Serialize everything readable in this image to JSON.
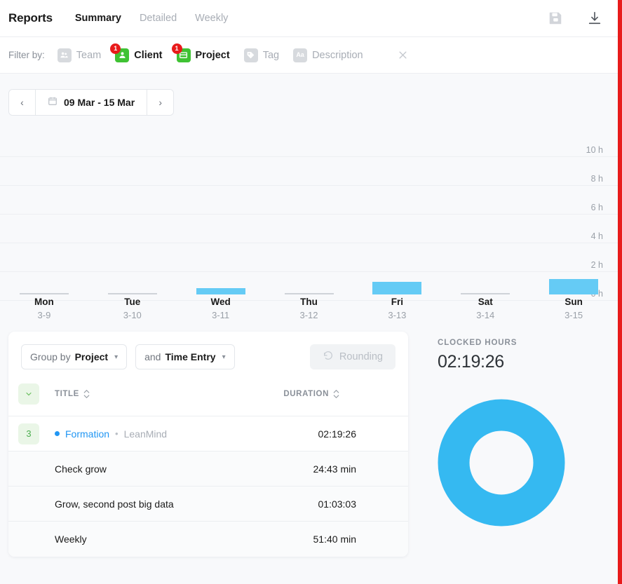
{
  "header": {
    "title": "Reports",
    "tabs": [
      {
        "label": "Summary",
        "active": true
      },
      {
        "label": "Detailed",
        "active": false
      },
      {
        "label": "Weekly",
        "active": false
      }
    ],
    "actions": [
      {
        "name": "save-icon",
        "label": "Save"
      },
      {
        "name": "download-icon",
        "label": "Download"
      }
    ]
  },
  "filter_bar": {
    "label": "Filter by:",
    "items": [
      {
        "label": "Team",
        "icon": "team-icon",
        "active": false,
        "badge": null
      },
      {
        "label": "Client",
        "icon": "client-icon",
        "active": true,
        "badge": "1"
      },
      {
        "label": "Project",
        "icon": "project-icon",
        "active": true,
        "badge": "1"
      },
      {
        "label": "Tag",
        "icon": "tag-icon",
        "active": false,
        "badge": null
      },
      {
        "label": "Description",
        "icon": "description-icon",
        "active": false,
        "badge": null
      }
    ],
    "clear_label": "Clear filters"
  },
  "date_nav": {
    "prev_label": "‹",
    "next_label": "›",
    "range": "09 Mar - 15 Mar"
  },
  "chart_data": {
    "type": "bar",
    "title": "",
    "xlabel": "",
    "ylabel": "",
    "ylim": [
      0,
      10
    ],
    "yticks": [
      "0 h",
      "2 h",
      "4 h",
      "6 h",
      "8 h",
      "10 h"
    ],
    "grid": true,
    "unit": "hours",
    "bar_color": "#65cbf5",
    "categories": [
      "Mon",
      "Tue",
      "Wed",
      "Thu",
      "Fri",
      "Sat",
      "Sun"
    ],
    "category_dates": [
      "3-9",
      "3-10",
      "3-11",
      "3-12",
      "3-13",
      "3-14",
      "3-15"
    ],
    "values": [
      0,
      0,
      0.41,
      0,
      0.86,
      0,
      1.05
    ]
  },
  "donut_chart": {
    "type": "pie",
    "title": "CLOCKED HOURS",
    "total_label": "02:19:26",
    "slices": [
      {
        "name": "Formation",
        "value": 100,
        "color": "#35b9f1"
      }
    ]
  },
  "report_card": {
    "group_by": {
      "prefix": "Group by",
      "value": "Project"
    },
    "sub_group": {
      "prefix": "and",
      "value": "Time Entry"
    },
    "rounding_label": "Rounding",
    "columns": {
      "title": "TITLE",
      "duration": "DURATION"
    },
    "groups": [
      {
        "count": "3",
        "project": "Formation",
        "separator": "•",
        "client": "LeanMind",
        "duration": "02:19:26",
        "entries": [
          {
            "title": "Check grow",
            "duration": "24:43 min"
          },
          {
            "title": "Grow, second post big data",
            "duration": "01:03:03"
          },
          {
            "title": "Weekly",
            "duration": "51:40 min"
          }
        ]
      }
    ]
  },
  "colors": {
    "accent_blue": "#35b9f1",
    "bar_blue": "#65cbf5",
    "link_blue": "#2196f3",
    "filter_green": "#3fc233",
    "badge_red": "#e81b1b",
    "page_bg": "#f8f9fb"
  }
}
